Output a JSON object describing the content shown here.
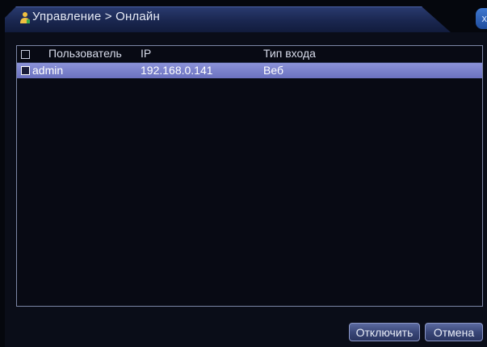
{
  "window": {
    "title": "Управление > Онлайн",
    "close_label": "x",
    "title_icon": "user-tools-icon"
  },
  "table": {
    "headers": {
      "user": "Пользователь",
      "ip": "IP",
      "login_type": "Тип входа"
    },
    "rows": [
      {
        "user": "admin",
        "ip": "192.168.0.141",
        "login_type": "Веб",
        "selected": true
      }
    ]
  },
  "buttons": {
    "disconnect": "Отключить",
    "cancel": "Отмена"
  },
  "colors": {
    "background": "#0a0d18",
    "title_tab": "#1a2750",
    "row_highlight": "#7a82cc",
    "button": "#3a4778"
  }
}
